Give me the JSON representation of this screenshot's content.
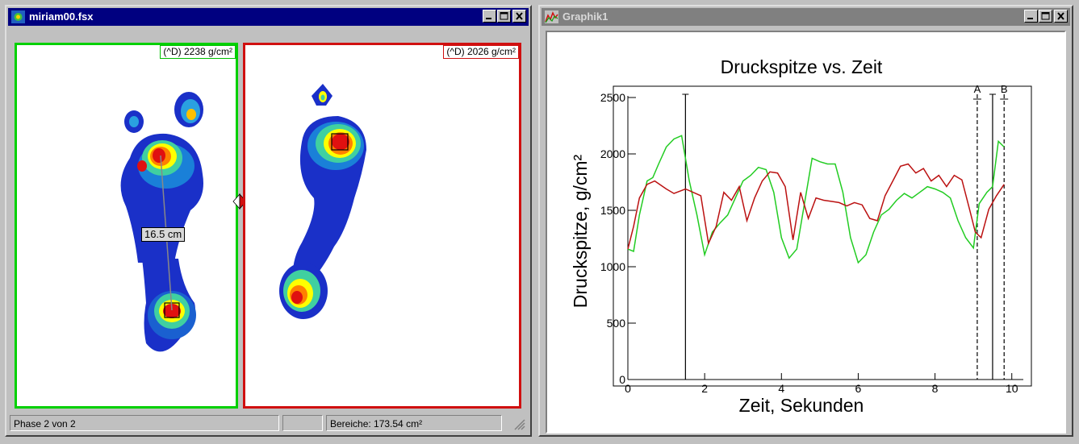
{
  "left_window": {
    "title": "miriam00.fsx",
    "left_foot_value": "(^D) 2238 g/cm²",
    "right_foot_value": "(^D) 2026 g/cm²",
    "distance_label": "16.5 cm",
    "status_phase": "Phase 2 von 2",
    "status_empty": "",
    "status_area": "Bereiche: 173.54 cm²"
  },
  "right_window": {
    "title": "Graphik1"
  },
  "colors": {
    "left_foot_border": "#00d000",
    "right_foot_border": "#d01010",
    "series_green": "#22cc22",
    "series_red": "#bb1111"
  },
  "chart_data": {
    "type": "line",
    "title": "Druckspitze vs. Zeit",
    "xlabel": "Zeit, Sekunden",
    "ylabel": "Druckspitze, g/cm²",
    "xlim": [
      0,
      10.3
    ],
    "ylim": [
      0,
      2500
    ],
    "xticks": [
      0,
      2,
      4,
      6,
      8,
      10
    ],
    "yticks": [
      0,
      500,
      1000,
      1500,
      2000,
      2500
    ],
    "grid": false,
    "markers": [
      {
        "x": 1.5,
        "label": "",
        "style": "solid"
      },
      {
        "x": 9.1,
        "label": "A",
        "style": "dashed"
      },
      {
        "x": 9.5,
        "label": "",
        "style": "solid"
      },
      {
        "x": 9.8,
        "label": "B",
        "style": "dashed"
      }
    ],
    "series": [
      {
        "color": "#22cc22",
        "x": [
          0,
          0.15,
          0.3,
          0.5,
          0.65,
          0.8,
          1.0,
          1.2,
          1.4,
          1.6,
          1.8,
          2.0,
          2.2,
          2.4,
          2.6,
          2.8,
          3.0,
          3.2,
          3.4,
          3.6,
          3.8,
          4.0,
          4.2,
          4.4,
          4.6,
          4.8,
          5.0,
          5.2,
          5.4,
          5.6,
          5.8,
          6.0,
          6.2,
          6.4,
          6.6,
          6.8,
          7.0,
          7.2,
          7.4,
          7.6,
          7.8,
          8.0,
          8.2,
          8.4,
          8.6,
          8.8,
          9.0,
          9.15,
          9.35,
          9.5,
          9.65,
          9.8
        ],
        "y": [
          1150,
          1130,
          1450,
          1750,
          1780,
          1900,
          2050,
          2120,
          2150,
          1750,
          1450,
          1100,
          1300,
          1380,
          1450,
          1600,
          1750,
          1800,
          1870,
          1850,
          1650,
          1250,
          1070,
          1150,
          1550,
          1950,
          1920,
          1900,
          1900,
          1650,
          1250,
          1030,
          1100,
          1300,
          1450,
          1500,
          1580,
          1640,
          1600,
          1650,
          1700,
          1680,
          1650,
          1600,
          1400,
          1250,
          1160,
          1550,
          1650,
          1700,
          2100,
          2050
        ]
      },
      {
        "color": "#bb1111",
        "x": [
          0,
          0.15,
          0.3,
          0.5,
          0.7,
          1.0,
          1.2,
          1.5,
          1.7,
          1.9,
          2.1,
          2.3,
          2.5,
          2.7,
          2.9,
          3.1,
          3.3,
          3.5,
          3.7,
          3.9,
          4.1,
          4.3,
          4.5,
          4.7,
          4.9,
          5.1,
          5.3,
          5.5,
          5.7,
          5.9,
          6.1,
          6.3,
          6.5,
          6.7,
          6.9,
          7.1,
          7.3,
          7.5,
          7.7,
          7.9,
          8.1,
          8.3,
          8.5,
          8.7,
          8.9,
          9.05,
          9.2,
          9.4,
          9.6,
          9.8
        ],
        "y": [
          1150,
          1350,
          1600,
          1720,
          1750,
          1680,
          1640,
          1680,
          1650,
          1620,
          1200,
          1350,
          1650,
          1580,
          1700,
          1400,
          1600,
          1750,
          1830,
          1820,
          1700,
          1230,
          1650,
          1420,
          1600,
          1580,
          1570,
          1560,
          1530,
          1560,
          1540,
          1420,
          1400,
          1620,
          1750,
          1880,
          1900,
          1820,
          1860,
          1750,
          1800,
          1700,
          1800,
          1760,
          1500,
          1300,
          1250,
          1500,
          1620,
          1720
        ]
      }
    ]
  }
}
